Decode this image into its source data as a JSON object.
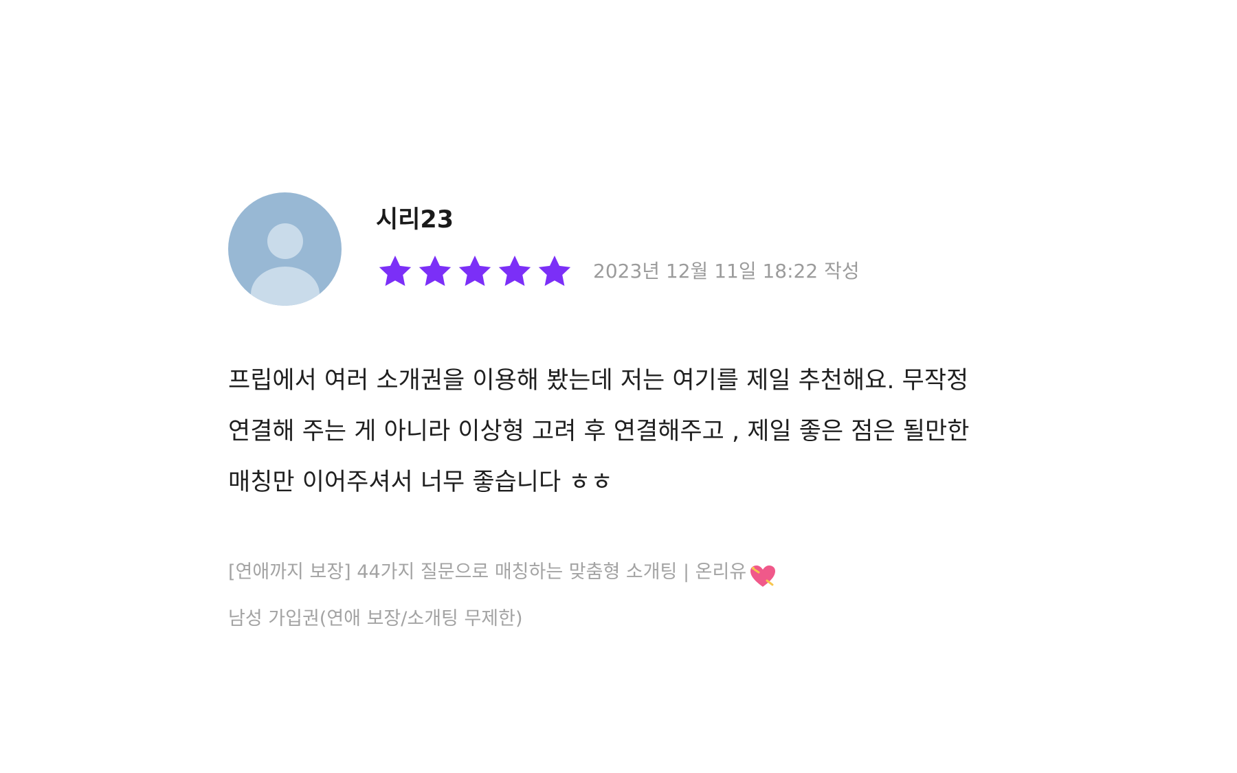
{
  "review": {
    "author": "시리23",
    "rating": 5,
    "rating_max": 5,
    "star_color": "#7b2ff7",
    "date": "2023년 12월 11일 18:22 작성",
    "body": "프립에서 여러 소개권을 이용해 봤는데 저는 여기를 제일 추천해요. 무작정 연결해 주는 게 아니라 이상형 고려 후 연결해주고 , 제일 좋은 점은 될만한 매칭만 이어주셔서 너무 좋습니다 ㅎㅎ",
    "product_title": "[연애까지 보장] 44가지 질문으로 매칭하는 맞춤형 소개팅 | 온리유",
    "product_emoji_icon": "heart-arrow-icon",
    "product_option": "남성 가입권(연애 보장/소개팅 무제한)"
  }
}
